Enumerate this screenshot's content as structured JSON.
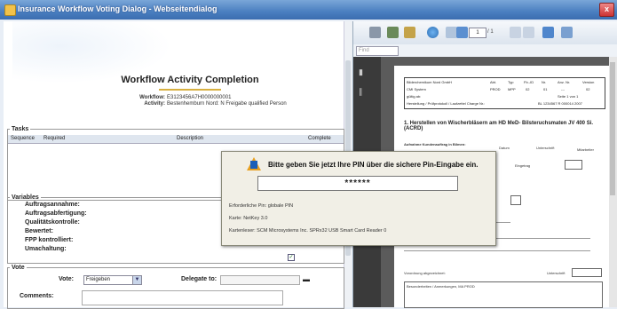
{
  "window": {
    "title": "Insurance Workflow Voting Dialog - Webseitendialog",
    "close_label": "x"
  },
  "form": {
    "heading": "Workflow Activity Completion",
    "workflow_label": "Workflow:",
    "workflow_value": "E3123456A7H0000000001",
    "activity_label": "Activity:",
    "activity_value": "Bestenhemburn Nord: N Freigabe qualified Person",
    "tasks": {
      "legend": "Tasks",
      "columns": [
        "Sequence",
        "Required",
        "Description",
        "Complete"
      ]
    },
    "variables": {
      "legend": "Variables",
      "rows": [
        "Auftragsannahme:",
        "Auftragsabfertigung:",
        "Qualitätskontrolle:",
        "Bewertet:",
        "FPP kontrolliert:",
        "Umachaltung:"
      ],
      "check": "✓"
    },
    "vote": {
      "legend": "Vote",
      "vote_label": "Vote:",
      "vote_value": "Freigeben",
      "delegate_label": "Delegate to:",
      "comment_label": "Comments:"
    }
  },
  "viewer": {
    "page_current": "1",
    "page_total": "/ 1",
    "find_placeholder": "Find"
  },
  "document": {
    "table": [
      "Bilderchemikum Nord GmbH",
      "Abt.",
      "Typ",
      "Fb.-ID",
      "Nr.",
      "Anz. Nr.",
      "Version",
      "CMI System",
      "PROD",
      "MPP",
      "02",
      "01",
      "---",
      "02",
      "gültig ab:",
      "Seite 1 von 1",
      "Herstellung / Prüfprotokoll / Laufzettel Charge Nr.:",
      "BL 1234567 R 000014 2007"
    ],
    "title": "1.  Herstellen von Wischerbläsern am HD MeD- Bilsteruchsmaten JV 400 Si. (ACRD)",
    "lines": [
      "Aufnahme Kundenauftrag in Bilmen:",
      "Datum",
      "Unterschrift",
      "Mitarbeiter",
      "Eingetrag"
    ],
    "footer": [
      "Vorordnung abgezeichnet:",
      "Unterschrift",
      "Besonderheiten / Anmerkungen, MA PROD"
    ]
  },
  "pin_dialog": {
    "message": "Bitte geben Sie jetzt Ihre PIN über die sichere Pin-Eingabe ein.",
    "masked": "******",
    "info": [
      "Erforderliche Pin: globale PIN",
      "Karte: NetKey 3.0",
      "Kartenleser: SCM Microsystems Inc. SPRx32 USB Smart Card Reader 0"
    ]
  }
}
